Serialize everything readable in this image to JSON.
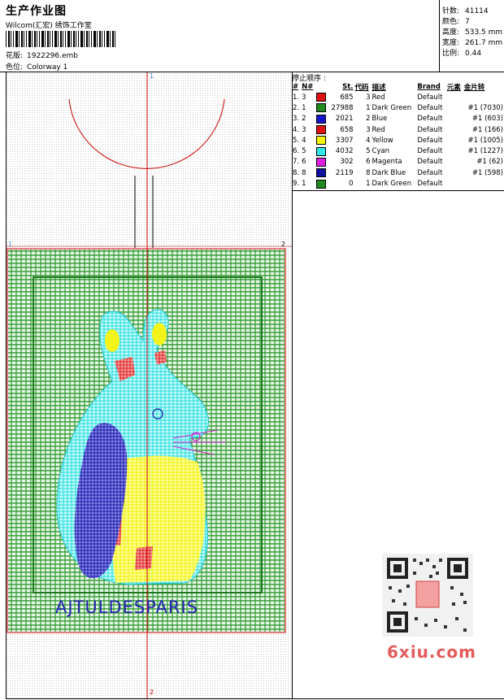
{
  "header": {
    "title": "生产作业图",
    "company": "Wilcom(汇宏) 绣饰工作室",
    "design_file_label": "花版:",
    "design_file": "1922296.emb",
    "colorway_label": "色位:",
    "colorway": "Colorway 1"
  },
  "stats": [
    {
      "label": "针数:",
      "value": "41114"
    },
    {
      "label": "颜色:",
      "value": "7"
    },
    {
      "label": "高度:",
      "value": "533.5 mm"
    },
    {
      "label": "宽度:",
      "value": "261.7 mm"
    },
    {
      "label": "比例:",
      "value": "0.44"
    }
  ],
  "stop_order": {
    "heading": "停止顺序 :",
    "columns": [
      "#",
      "N#",
      "St.",
      "代码",
      "描述",
      "Brand",
      "元素",
      "金片转"
    ],
    "rows": [
      {
        "index": "1.",
        "needle": "3",
        "stitches": "685",
        "code": "3",
        "desc": "Red",
        "brand": "Default",
        "element": "",
        "sequin": "",
        "color": "#e01010"
      },
      {
        "index": "2.",
        "needle": "1",
        "stitches": "27988",
        "code": "1",
        "desc": "Dark Green",
        "brand": "Default",
        "element": "",
        "sequin": "#1 (7030)",
        "color": "#1f8a1f"
      },
      {
        "index": "3.",
        "needle": "2",
        "stitches": "2021",
        "code": "2",
        "desc": "Blue",
        "brand": "Default",
        "element": "",
        "sequin": "#1 (603)",
        "color": "#1414c8"
      },
      {
        "index": "4.",
        "needle": "3",
        "stitches": "658",
        "code": "3",
        "desc": "Red",
        "brand": "Default",
        "element": "",
        "sequin": "#1 (166)",
        "color": "#e01010"
      },
      {
        "index": "5.",
        "needle": "4",
        "stitches": "3307",
        "code": "4",
        "desc": "Yellow",
        "brand": "Default",
        "element": "",
        "sequin": "#1 (1005)",
        "color": "#f5f500"
      },
      {
        "index": "6.",
        "needle": "5",
        "stitches": "4032",
        "code": "5",
        "desc": "Cyan",
        "brand": "Default",
        "element": "",
        "sequin": "#1 (1227)",
        "color": "#2ee8e8"
      },
      {
        "index": "7.",
        "needle": "6",
        "stitches": "302",
        "code": "6",
        "desc": "Magenta",
        "brand": "Default",
        "element": "",
        "sequin": "#1 (62)",
        "color": "#e020e0"
      },
      {
        "index": "8.",
        "needle": "8",
        "stitches": "2119",
        "code": "8",
        "desc": "Dark Blue",
        "brand": "Default",
        "element": "",
        "sequin": "#1 (598)",
        "color": "#1010a0"
      },
      {
        "index": "9.",
        "needle": "1",
        "stitches": "0",
        "code": "1",
        "desc": "Dark Green",
        "brand": "Default",
        "element": "",
        "sequin": "",
        "color": "#1f8a1f"
      }
    ]
  },
  "canvas": {
    "axis_markers": {
      "top": "1",
      "bottom": "2",
      "left": "1",
      "right": "2"
    },
    "design_text": "AJTULDESPARIS",
    "watermark": "6xiu.com"
  },
  "colors": {
    "frame_green": "#2f9a2f",
    "cyan": "#37e0e0",
    "yellow": "#f3f31a",
    "dark_blue": "#2323b0",
    "red": "#e03030",
    "magenta": "#d020d0",
    "guide_red": "#cc0000"
  }
}
